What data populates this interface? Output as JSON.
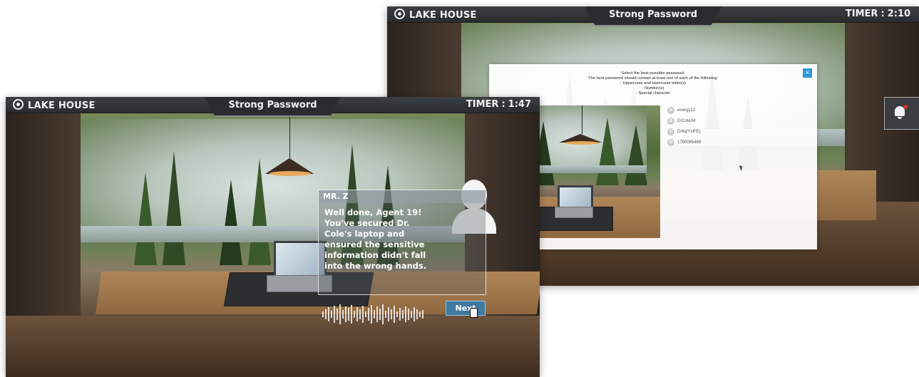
{
  "front_screen": {
    "hud": {
      "location": "LAKE HOUSE",
      "title": "Strong Password",
      "timer_label": "TIMER",
      "timer_sep": ":",
      "timer_value": "1:47"
    },
    "dialog": {
      "speaker": "MR. Z",
      "message": "Well done, Agent 19! You've secured Dr. Cole's laptop and ensured the sensitive information didn't fall into the wrong hands."
    },
    "next_label": "Next"
  },
  "back_screen": {
    "hud": {
      "location": "LAKE HOUSE",
      "title": "Strong Password",
      "timer_label": "TIMER",
      "timer_sep": ":",
      "timer_value": "2:10"
    },
    "modal": {
      "instructions": [
        "Select the best possible password.",
        "The best password should contain at least one of each of the following:",
        "- Uppercase and lowercase letter(s)",
        "- Number(s)",
        "- Special character"
      ],
      "close_label": "×",
      "options": [
        {
          "letter": "A",
          "text": "energy12"
        },
        {
          "letter": "B",
          "text": "DrCole34"
        },
        {
          "letter": "C",
          "text": "Dr6q!YsiFE)"
        },
        {
          "letter": "D",
          "text": "1760065469"
        }
      ]
    }
  }
}
